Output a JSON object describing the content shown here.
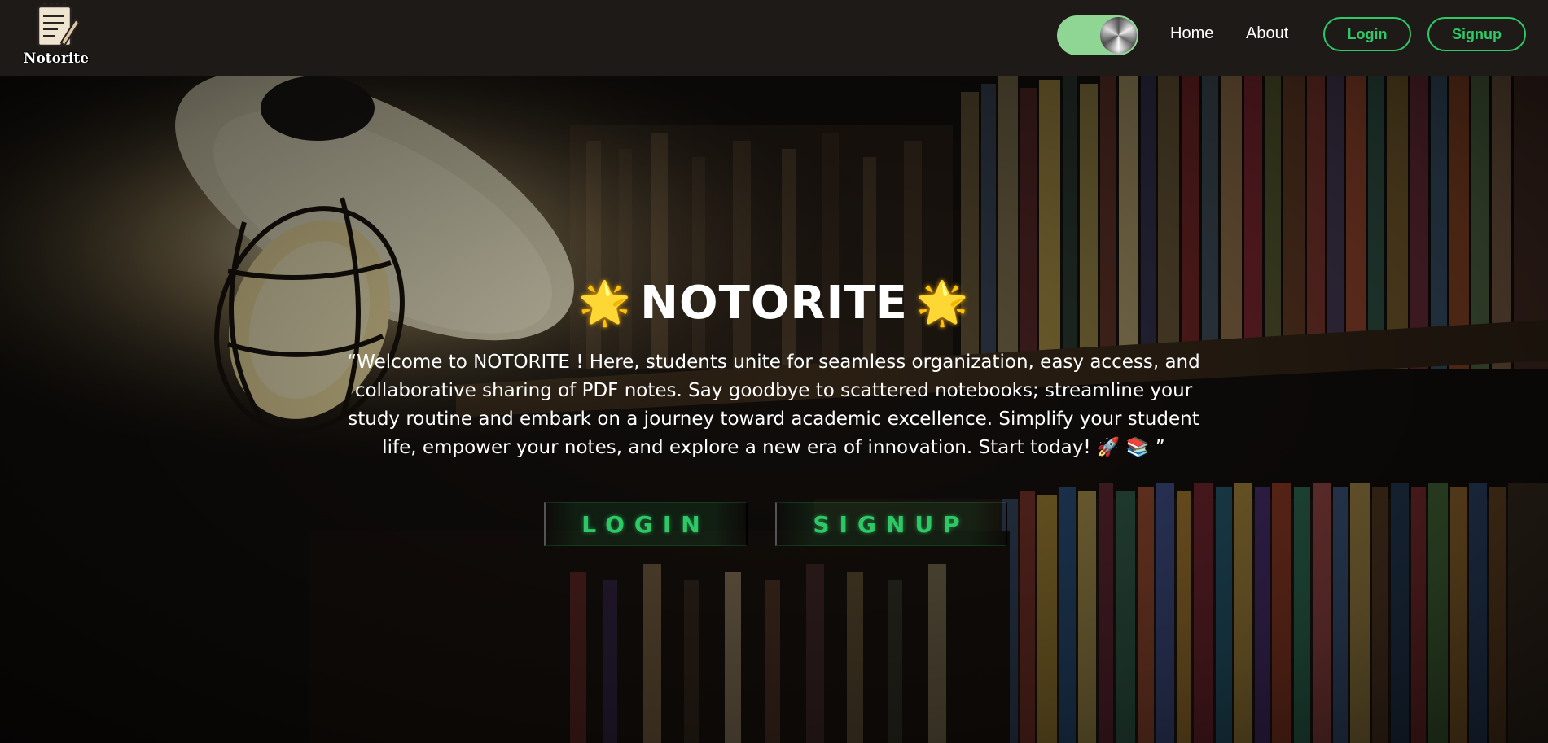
{
  "navbar": {
    "logo_text": "Notorite",
    "links": {
      "home": "Home",
      "about": "About"
    },
    "buttons": {
      "login": "Login",
      "signup": "Signup"
    },
    "accent_color": "#2ec866"
  },
  "hero": {
    "star_glyph": "🌟",
    "title": "NOTORITE",
    "description": "“Welcome to NOTORITE ! Here, students unite for seamless organization, easy access, and collaborative sharing of PDF notes. Say goodbye to scattered notebooks; streamline your study routine and embark on a journey toward academic excellence. Simplify your student life, empower your notes, and explore a new era of innovation. Start today! 🚀 📚 ”",
    "buttons": {
      "login": "LOGIN",
      "signup": "SIGNUP"
    }
  }
}
